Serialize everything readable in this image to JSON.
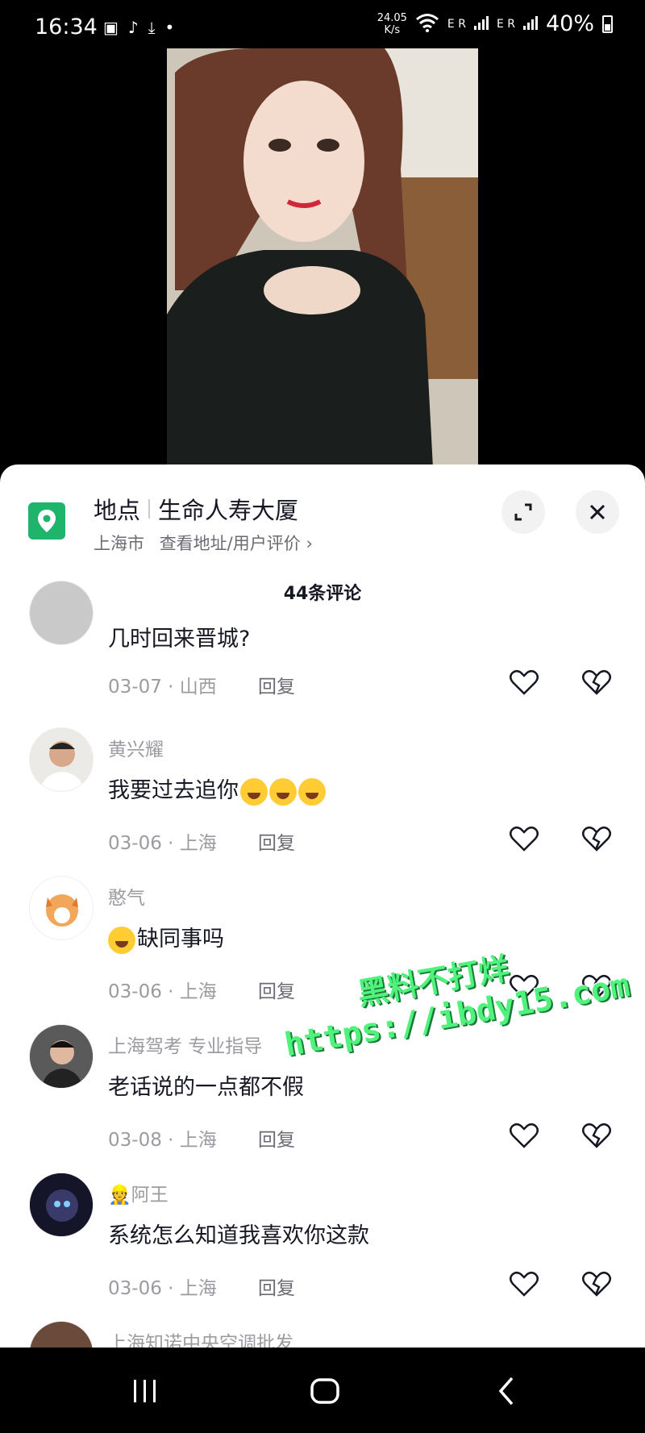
{
  "status_bar": {
    "time": "16:34",
    "net_speed_value": "24.05",
    "net_speed_unit": "K/s",
    "signal1": "E R",
    "signal2": "E R",
    "battery": "40%"
  },
  "location": {
    "label": "地点",
    "name": "生命人寿大厦",
    "city": "上海市",
    "link": "查看地址/用户评价",
    "accent_color": "#1fb46b"
  },
  "comments_header": {
    "count_text": "44条评论"
  },
  "comments": [
    {
      "username": "",
      "text": "几时回来晋城?",
      "meta": "03-07 · 山西",
      "reply": "回复"
    },
    {
      "username": "黄兴耀",
      "text": "我要过去追你",
      "meta": "03-06 · 上海",
      "reply": "回复"
    },
    {
      "username": "憨气",
      "text": "缺同事吗",
      "meta": "03-06 · 上海",
      "reply": "回复"
    },
    {
      "username": "上海驾考 专业指导",
      "text": "老话说的一点都不假",
      "meta": "03-08 · 上海",
      "reply": "回复"
    },
    {
      "username": "阿王",
      "text": "系统怎么知道我喜欢你这款",
      "meta": "03-06 · 上海",
      "reply": "回复"
    },
    {
      "username": "上海知诺中央空调批发",
      "text": "",
      "meta": "",
      "reply": ""
    }
  ],
  "watermark": {
    "line1": "黑料不打烊",
    "line2": "https://ibdy15.com"
  },
  "icons": {
    "location": "map-pin-icon",
    "expand": "expand-icon",
    "close": "close-icon",
    "like": "heart-icon",
    "dislike": "broken-heart-icon"
  }
}
